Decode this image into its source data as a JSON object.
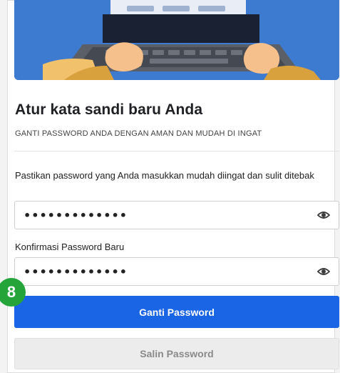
{
  "page": {
    "title": "Atur kata sandi baru Anda",
    "subtitle": "GANTI PASSWORD ANDA DENGAN AMAN DAN MUDAH DI INGAT"
  },
  "form": {
    "password_label": "Pastikan password yang Anda masukkan mudah diingat dan sulit ditebak",
    "password_value": "•••••••••••••",
    "confirm_label": "Konfirmasi Password Baru",
    "confirm_value": "•••••••••••••",
    "show_icon": "eye-icon"
  },
  "buttons": {
    "submit_label": "Ganti Password",
    "copy_label": "Salin Password"
  },
  "step_badge": "8",
  "colors": {
    "primary": "#1a64e6",
    "hero": "#3d7bd0",
    "badge": "#25a43a",
    "secondary_bg": "#ececec"
  }
}
